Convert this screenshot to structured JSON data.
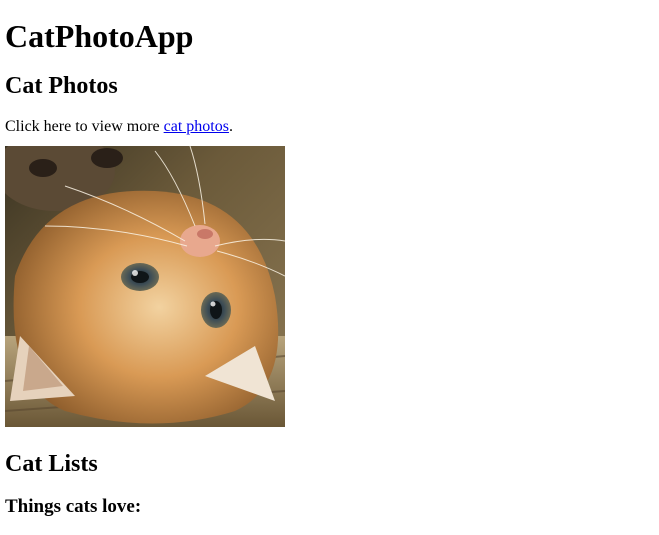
{
  "page": {
    "title": "CatPhotoApp"
  },
  "photos_section": {
    "heading": "Cat Photos",
    "intro_before": "Click here to view more ",
    "link_text": "cat photos",
    "intro_after": ".",
    "image_alt": "A cute orange cat lying on its back."
  },
  "lists_section": {
    "heading": "Cat Lists",
    "subheading": "Things cats love:"
  },
  "colors": {
    "link": "#0000ee",
    "text": "#000000",
    "background": "#ffffff"
  }
}
